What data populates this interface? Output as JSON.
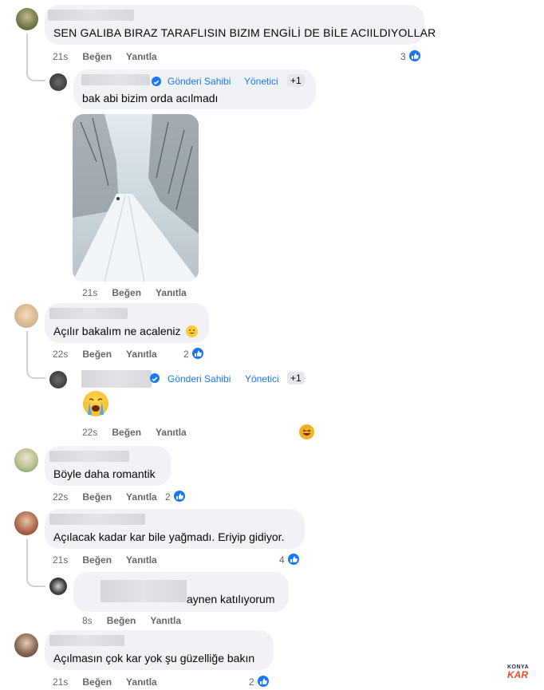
{
  "labels": {
    "like": "Beğen",
    "reply": "Yanıtla",
    "author": "Gönderi Sahibi",
    "admin": "Yönetici",
    "plus": "+1"
  },
  "c1": {
    "text": "SEN GALIBA BIRAZ TARAFLISIN BIZIM ENGİLİ DE BİLE ACIILDIYOLLAR",
    "time": "21s",
    "likes": "3"
  },
  "r1": {
    "text": "bak abi bizim orda acılmadı",
    "time": "21s"
  },
  "c2": {
    "text": "Açılır bakalım ne acaleniz",
    "time": "22s",
    "likes": "2"
  },
  "r2": {
    "time": "22s"
  },
  "c3": {
    "text": "Böyle daha romantik",
    "time": "22s",
    "likes": "2"
  },
  "c4": {
    "text": "Açılacak kadar kar bile yağmadı. Eriyip gidiyor.",
    "time": "21s",
    "likes": "4"
  },
  "r4": {
    "text": "aynen katılıyorum",
    "time": "8s"
  },
  "c5": {
    "text": "Açılmasın çok kar yok şu güzelliğe bakın",
    "time": "21s",
    "likes": "2"
  },
  "watermark": {
    "line1": "KONYA",
    "line2": "KAR"
  },
  "colors": {
    "accent": "#1877f2",
    "bubble": "#f0f2f5",
    "meta": "#65676b"
  }
}
